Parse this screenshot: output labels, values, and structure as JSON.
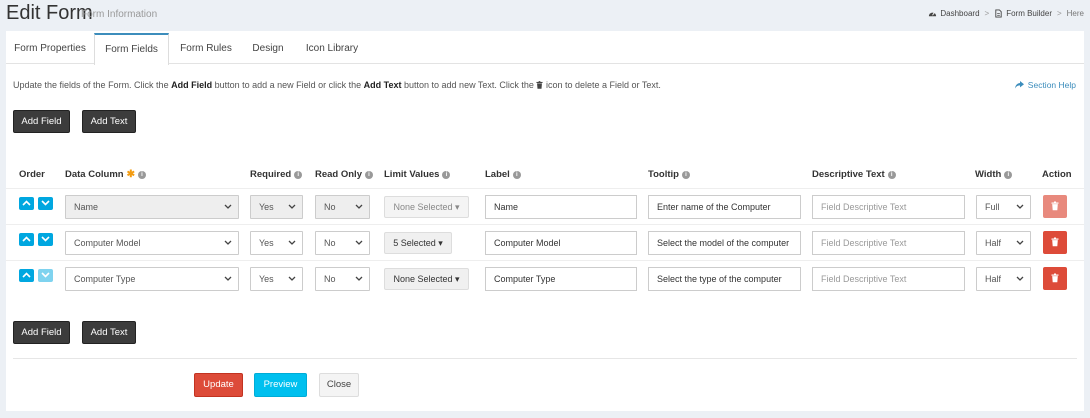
{
  "header": {
    "title": "Edit Form",
    "subtitle": "Form Information",
    "breadcrumb": {
      "dashboard": "Dashboard",
      "form_builder": "Form Builder",
      "here": "Here"
    }
  },
  "tabs": [
    {
      "label": "Form Properties"
    },
    {
      "label": "Form Fields",
      "active": true
    },
    {
      "label": "Form Rules"
    },
    {
      "label": "Design"
    },
    {
      "label": "Icon Library"
    }
  ],
  "info": {
    "t1": "Update the fields of the Form. Click the ",
    "b1": "Add Field",
    "t2": " button to add a new Field or click the ",
    "b2": "Add Text",
    "t3": " button to add new Text. Click the ",
    "t4": " icon to delete a Field or Text.",
    "help": "Section Help"
  },
  "buttons": {
    "add_field": "Add Field",
    "add_text": "Add Text",
    "update": "Update",
    "preview": "Preview",
    "close": "Close"
  },
  "table": {
    "headers": {
      "order": "Order",
      "data_column": "Data Column",
      "required": "Required",
      "read_only": "Read Only",
      "limit_values": "Limit Values",
      "label": "Label",
      "tooltip": "Tooltip",
      "descriptive_text": "Descriptive Text",
      "width": "Width",
      "action": "Action"
    },
    "rows": [
      {
        "data_column": "Name",
        "required": "Yes",
        "read_only": "No",
        "limit_values": "None Selected",
        "label": "Name",
        "tooltip": "Enter name of the Computer",
        "descriptive_text": "Field Descriptive Text",
        "width": "Full"
      },
      {
        "data_column": "Computer Model",
        "required": "Yes",
        "read_only": "No",
        "limit_values": "5 Selected",
        "label": "Computer Model",
        "tooltip": "Select the model of the computer",
        "descriptive_text": "Field Descriptive Text",
        "width": "Half"
      },
      {
        "data_column": "Computer Type",
        "required": "Yes",
        "read_only": "No",
        "limit_values": "None Selected",
        "label": "Computer Type",
        "tooltip": "Select the type of the computer",
        "descriptive_text": "Field Descriptive Text",
        "width": "Half"
      }
    ]
  },
  "colors": {
    "accent": "#3c8dbc",
    "danger": "#dd4b39",
    "info": "#00c0ef",
    "order_arrow": "#00a7e0",
    "dark_button": "#3c3c3c"
  }
}
